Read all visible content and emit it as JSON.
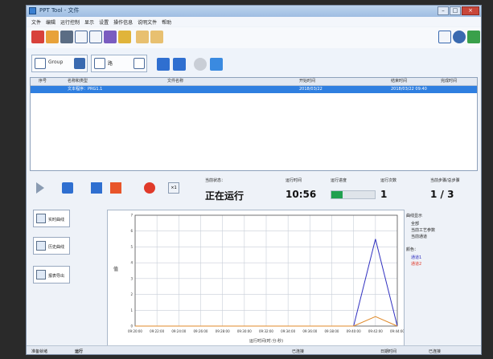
{
  "window": {
    "title": "PPT Tool - 文件"
  },
  "menu": [
    "文件",
    "编辑",
    "运行控制",
    "显示",
    "设置",
    "操作信息",
    "说明文件",
    "帮助"
  ],
  "toolbar2": {
    "mode_label": "Group",
    "field_label": "路"
  },
  "list": {
    "columns": [
      "序号",
      "名称和类型",
      "文件名称",
      "开始时间",
      "结束时间",
      "完成时间"
    ],
    "rows": [
      {
        "index": "",
        "name": "文本程序：PRG1.1",
        "file": "",
        "start": "2018/03/22",
        "end": "",
        "done": "2018/03/22 09:40"
      }
    ]
  },
  "status": {
    "state_label": "当前状态：",
    "state_value": "正在运行",
    "time_label": "运行时间",
    "time_value": "10:56",
    "progress_label": "运行进度",
    "progress_fraction": 0.25,
    "count_label": "运行次数",
    "count_value": "1",
    "step_label": "当前步骤/总步骤",
    "step_value": "1 / 3"
  },
  "side_buttons": [
    {
      "label": "实时曲线"
    },
    {
      "label": "历史曲线"
    },
    {
      "label": "报表导出"
    }
  ],
  "chart_data": {
    "type": "line",
    "x": [
      "09:20:00",
      "09:22:00",
      "09:24:00",
      "09:26:00",
      "09:28:00",
      "09:30:00",
      "09:32:00",
      "09:34:00",
      "09:36:00",
      "09:38:00",
      "09:40:00",
      "09:42:00",
      "09:44:00"
    ],
    "ylim": [
      0,
      7
    ],
    "grid": true,
    "xlabel": "运行时间(时:分:秒)",
    "ylabel": "值",
    "series": [
      {
        "name": "通道1",
        "values": [
          0,
          0,
          0,
          0,
          0,
          0,
          0,
          0,
          0,
          0,
          0,
          5.5,
          0
        ],
        "color": "#3030c0"
      },
      {
        "name": "通道2",
        "values": [
          0,
          0,
          0,
          0,
          0,
          0,
          0,
          0,
          0,
          0,
          0,
          0.6,
          0
        ],
        "color": "#e08a2a"
      }
    ]
  },
  "legend": {
    "group_title": "曲线显示",
    "options": [
      "全部",
      "当前工艺参数",
      "当前通道"
    ],
    "group2_title": "颜色：",
    "colors": [
      "通道1",
      "通道2"
    ]
  },
  "statusbar": {
    "left": "准备就绪",
    "mid": "运行",
    "item3": "已连接",
    "right1": "日期时间",
    "right2": "已连接"
  },
  "colors": {
    "accent": "#2f7fe0",
    "progress": "#20a050",
    "record": "#e03a2a"
  }
}
